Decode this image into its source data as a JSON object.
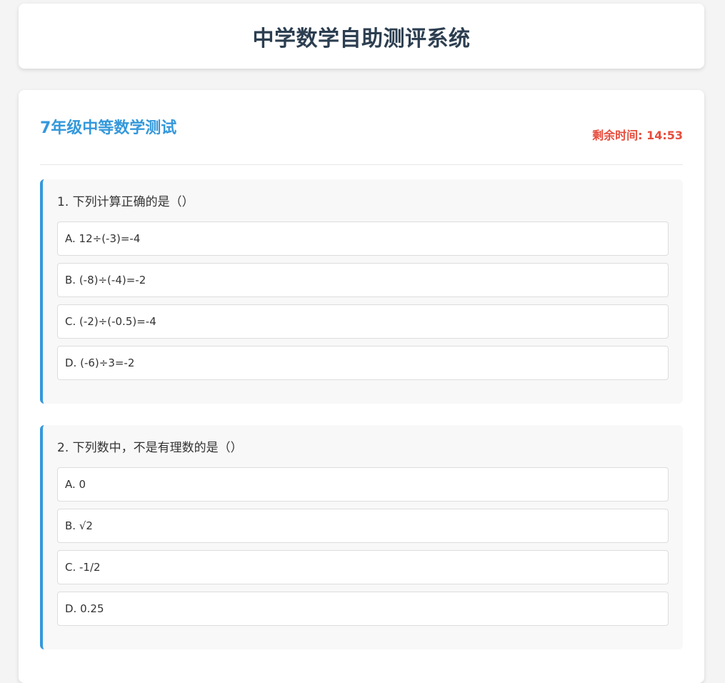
{
  "app_title": "中学数学自助测评系统",
  "quiz": {
    "title": "7年级中等数学测试",
    "timer": "剩余时间: 14:53"
  },
  "questions": [
    {
      "text": "1. 下列计算正确的是（）",
      "options": [
        "A. 12÷(-3)=-4",
        "B. (-8)÷(-4)=-2",
        "C. (-2)÷(-0.5)=-4",
        "D. (-6)÷3=-2"
      ]
    },
    {
      "text": "2. 下列数中，不是有理数的是（）",
      "options": [
        "A. 0",
        "B. √2",
        "C. -1/2",
        "D. 0.25"
      ]
    }
  ],
  "colors": {
    "accent": "#3498db",
    "timer": "#e74c3c",
    "heading": "#2c3e50",
    "page_background": "#f4f4f4"
  }
}
